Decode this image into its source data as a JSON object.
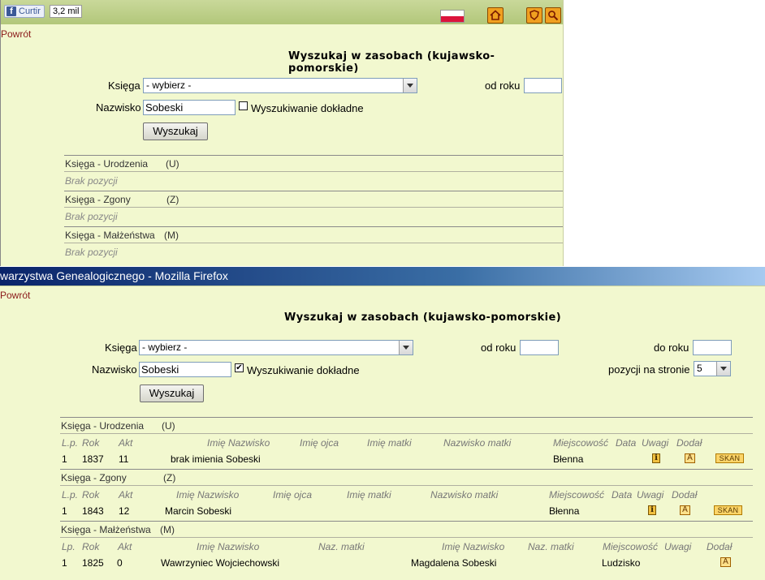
{
  "social": {
    "fb_button": "Curtir",
    "fb_logo": "f",
    "fb_count": "3,2 mil"
  },
  "icons": {
    "flag": "polish-flag-icon",
    "home": "home-icon",
    "map": "map-icon",
    "search": "magnifier-icon"
  },
  "firefox_title": "warzystwa Genealogicznego - Mozilla Firefox",
  "window1": {
    "back": "Powrót",
    "title": "Wyszukaj w zasobach (kujawsko-pomorskie)",
    "ksiega_label": "Księga",
    "ksiega_value": "- wybierz -",
    "od_roku_label": "od roku",
    "od_roku_value": "",
    "nazwisko_label": "Nazwisko",
    "nazwisko_value": "Sobeski",
    "exact_label": "Wyszukiwanie dokładne",
    "exact_checked": false,
    "search_button": "Wyszukaj",
    "sections": [
      {
        "label": "Księga - Urodzenia",
        "code": "(U)",
        "empty": "Brak pozycji"
      },
      {
        "label": "Księga - Zgony",
        "code": "(Z)",
        "empty": "Brak pozycji"
      },
      {
        "label": "Księga - Małżeństwa",
        "code": "(M)",
        "empty": "Brak pozycji"
      }
    ]
  },
  "window2": {
    "back": "Powrót",
    "title": "Wyszukaj w zasobach (kujawsko-pomorskie)",
    "ksiega_label": "Księga",
    "ksiega_value": "- wybierz -",
    "od_roku_label": "od roku",
    "od_roku_value": "",
    "do_roku_label": "do roku",
    "do_roku_value": "",
    "nazwisko_label": "Nazwisko",
    "nazwisko_value": "Sobeski",
    "exact_label": "Wyszukiwanie dokładne",
    "exact_checked": true,
    "exact_check_glyph": "✔",
    "per_page_label": "pozycji na stronie",
    "per_page_value": "5",
    "search_button": "Wyszukaj",
    "urodzenia": {
      "label": "Księga - Urodzenia",
      "code": "(U)",
      "headers": [
        "L.p.",
        "Rok",
        "Akt",
        "Imię Nazwisko",
        "Imię ojca",
        "Imię matki",
        "Nazwisko matki",
        "Miejscowość",
        "Data",
        "Uwagi",
        "Dodał"
      ],
      "row": {
        "lp": "1",
        "rok": "1837",
        "akt": "11",
        "imie_nazwisko": "brak imienia Sobeski",
        "miejscowosc": "Błenna",
        "info": "i",
        "added": "A",
        "scan": "SKAN"
      }
    },
    "zgony": {
      "label": "Księga - Zgony",
      "code": "(Z)",
      "headers": [
        "L.p.",
        "Rok",
        "Akt",
        "Imię Nazwisko",
        "Imię ojca",
        "Imię matki",
        "Nazwisko matki",
        "Miejscowość",
        "Data",
        "Uwagi",
        "Dodał"
      ],
      "row": {
        "lp": "1",
        "rok": "1843",
        "akt": "12",
        "imie_nazwisko": "Marcin Sobeski",
        "miejscowosc": "Błenna",
        "info": "i",
        "added": "A",
        "scan": "SKAN"
      }
    },
    "malzenstwa": {
      "label": "Księga - Małżeństwa",
      "code": "(M)",
      "headers": [
        "Lp.",
        "Rok",
        "Akt",
        "Imię Nazwisko",
        "Naz. matki",
        "Imię Nazwisko",
        "Naz. matki",
        "Miejscowość",
        "Uwagi",
        "Dodał"
      ],
      "row": {
        "lp": "1",
        "rok": "1825",
        "akt": "0",
        "groom": "Wawrzyniec Wojciechowski",
        "bride": "Magdalena Sobeski",
        "miejscowosc": "Ludzisko",
        "added": "A"
      }
    }
  }
}
